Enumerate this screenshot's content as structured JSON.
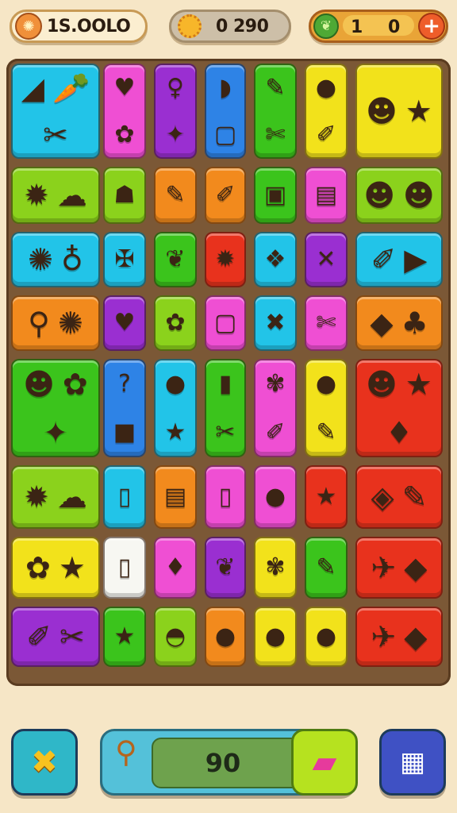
{
  "hud": {
    "coins": "1S.OOLO",
    "sun_value": "0 290",
    "energy_left": "1",
    "energy_right": "0",
    "coin_icon": "coin-icon",
    "sun_icon": "sun-icon",
    "leaf_icon": "leaf-icon",
    "plus_label": "+"
  },
  "hint": {
    "count": "90",
    "key_icon": "key-icon",
    "eraser_icon": "eraser-icon"
  },
  "buttons": {
    "shuffle_icon": "shuffle-icon",
    "menu_icon": "grid-menu-icon"
  },
  "colors": {
    "background": "#f6e6c6",
    "board": "#7b5836",
    "lime": "#8bd21c",
    "yellow": "#f2e21b",
    "orange": "#f28a1d",
    "red": "#e8321d",
    "pink": "#ef4fd3",
    "purple": "#9a2fd1",
    "blue": "#2e83e6",
    "cyan": "#22c4e8",
    "green": "#3bc41c"
  }
}
